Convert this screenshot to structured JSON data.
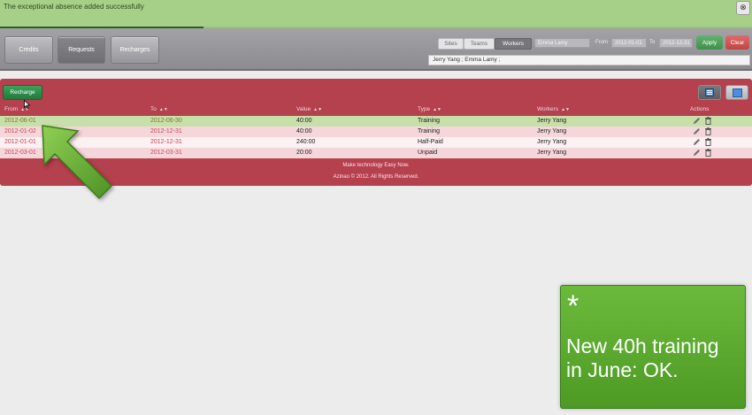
{
  "notification": {
    "message": "The exceptional absence added successfully",
    "close_icon": "close-icon",
    "progress": 0.27
  },
  "toolbar": {
    "tabs": [
      {
        "label": "Credits",
        "active": false
      },
      {
        "label": "Requests",
        "active": true
      },
      {
        "label": "Recharges",
        "active": false
      }
    ],
    "filter_segments": [
      {
        "label": "Sites",
        "active": false
      },
      {
        "label": "Teams",
        "active": false
      },
      {
        "label": "Workers",
        "active": true
      }
    ],
    "worker_field": "Emma Lamy",
    "from_label": "From",
    "from_value": "2012-01-01",
    "to_label": "To",
    "to_value": "2012-12-31",
    "apply_label": "Apply",
    "clear_label": "Clear",
    "selected_workers": "Jerry Yang ; Emma Lamy ;"
  },
  "panel": {
    "recharge_button": "Recharge",
    "columns": [
      "From",
      "To",
      "Value",
      "Type",
      "Workers",
      "Actions"
    ],
    "rows": [
      {
        "from": "2012-06-01",
        "to": "2012-06-30",
        "value": "40:00",
        "type": "Training",
        "workers": "Jerry Yang",
        "highlight": true
      },
      {
        "from": "2012-01-02",
        "to": "2012-12-31",
        "value": "40:00",
        "type": "Training",
        "workers": "Jerry Yang",
        "highlight": false
      },
      {
        "from": "2012-01-01",
        "to": "2012-12-31",
        "value": "240:00",
        "type": "Half-Paid",
        "workers": "Jerry Yang",
        "highlight": false
      },
      {
        "from": "2012-03-01",
        "to": "2012-03-31",
        "value": "20:00",
        "type": "Unpaid",
        "workers": "Jerry Yang",
        "highlight": false
      }
    ],
    "footer_tagline": "Make technology Easy Now.",
    "footer_copyright": "Azinao © 2012. All Rights Reserved."
  },
  "caption": {
    "star": "*",
    "text": "New 40h training in June: OK."
  },
  "colors": {
    "notify_bg": "#a6cf88",
    "panel_bg": "#b5404e",
    "highlight_row": "#c7dfa8",
    "caption_bg": "#5fae30",
    "arrow": "#6aa83b"
  }
}
